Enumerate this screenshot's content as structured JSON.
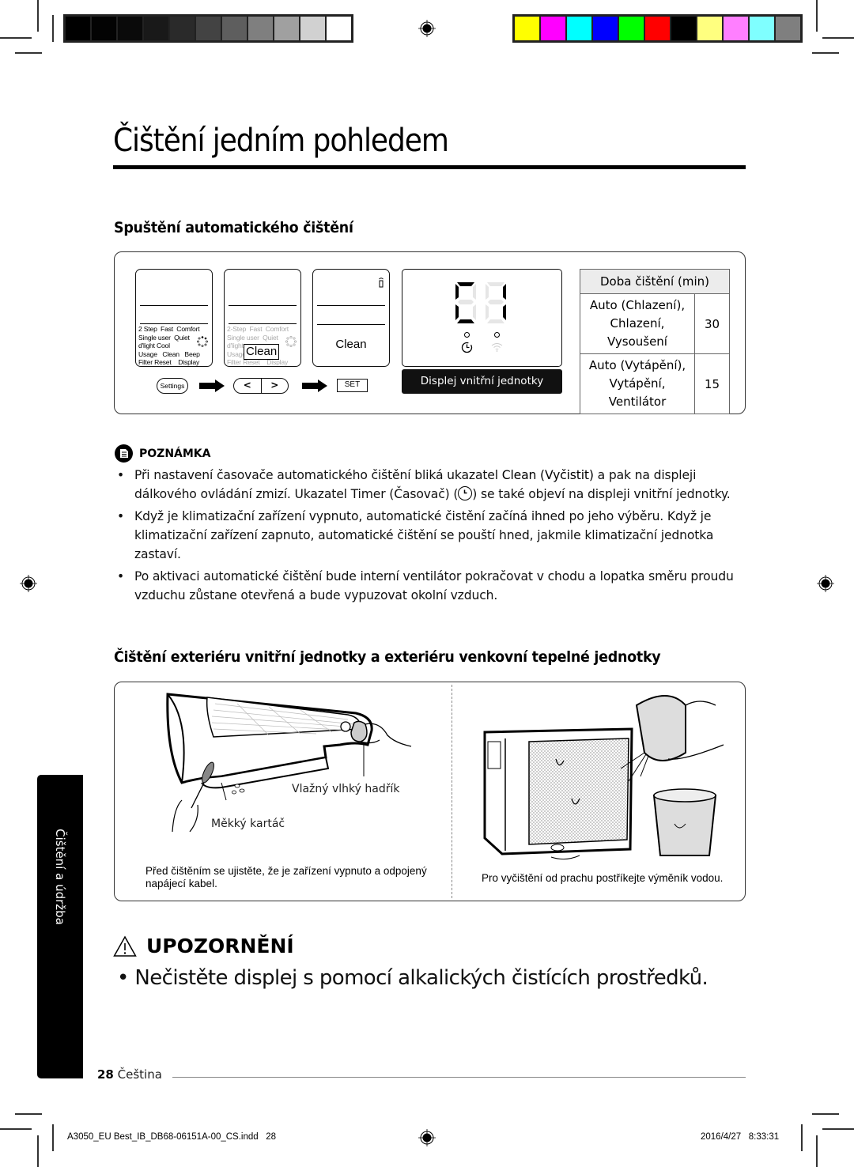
{
  "print_marks": {
    "gray_swatches": [
      "#000000",
      "#030303",
      "#0a0a0a",
      "#191919",
      "#2a2a2a",
      "#434343",
      "#5e5e5e",
      "#7f7f7f",
      "#a0a0a0",
      "#d1d1d1",
      "#ffffff"
    ],
    "color_swatches": [
      "#ffff00",
      "#ff00ff",
      "#00ffff",
      "#0000ff",
      "#00ff00",
      "#ff0000",
      "#000000",
      "#ffff7f",
      "#ff7fff",
      "#7fffff",
      "#7f7f7f"
    ]
  },
  "page": {
    "title": "Čištění jedním pohledem",
    "section1_heading": "Spuštění automatického čištění",
    "section2_heading": "Čištění exteriéru vnitřní jednotky a exteriéru venkovní tepelné jednotky"
  },
  "remote": {
    "options_lines": [
      "2 Step  Fast  Comfort",
      "Single user  Quiet",
      "d'light Cool",
      "Usage   Clean   Beep",
      "Filter Reset    Display"
    ],
    "options_lines_dim": [
      "2-Step  Fast  Comfort",
      "Single user  Quiet",
      "d'light",
      "Usage",
      "Filter Reset    Display"
    ],
    "highlight_label": "Clean",
    "screen3_label": "Clean",
    "settings_button": "Settings",
    "left_button": "<",
    "right_button": ">",
    "set_button": "SET"
  },
  "indoor_display": {
    "digits": "C1",
    "digit1_segments_on": [
      "a",
      "d",
      "e",
      "f"
    ],
    "digit2_segments_on": [
      "b",
      "c"
    ],
    "timer_icon": "timer-icon",
    "wifi_icon": "wifi-icon",
    "label": "Displej vnitřní jednotky"
  },
  "clean_time_table": {
    "header": "Doba čištění (min)",
    "rows": [
      {
        "modes": [
          "Auto (Chlazení),",
          "Chlazení,",
          "Vysoušení"
        ],
        "minutes": "30"
      },
      {
        "modes": [
          "Auto (Vytápění),",
          "Vytápění,",
          "Ventilátor"
        ],
        "minutes": "15"
      }
    ]
  },
  "note": {
    "heading": "POZNÁMKA",
    "b1_part1": "Při nastavení časovače automatického čištění bliká ukazatel ",
    "b1_bold": "Clean (Vyčistit)",
    "b1_part2": " a pak na displeji dálkového ovládání zmizí. Ukazatel Timer (Časovač) (",
    "b1_part3": ") se také objeví na displeji vnitřní jednotky.",
    "b2": "Když je klimatizační zařízení vypnuto, automatické čistění začíná ihned po jeho výběru. Když je klimatizační zařízení zapnuto, automatické čištění se pouští hned, jakmile klimatizační jednotka zastaví.",
    "b3": "Po aktivaci automatické čištění bude interní ventilátor pokračovat v chodu a lopatka směru proudu vzduchu zůstane otevřená a bude vypuzovat okolní vzduch."
  },
  "illustration": {
    "label_cloth": "Vlažný vlhký hadřík",
    "label_brush": "Měkký kartáč",
    "caption_left": "Před čištěním se ujistěte, že je zařízení vypnuto a odpojený napájecí kabel.",
    "caption_right": "Pro vyčištění od prachu postříkejte výměník vodou."
  },
  "side_tab": "Čištění a údržba",
  "warning": {
    "heading": "UPOZORNĚNÍ",
    "text": "Nečistěte displej s pomocí alkalických čistících prostředků."
  },
  "footer": {
    "page_number": "28",
    "language": "Čeština",
    "slug_file": "A3050_EU Best_IB_DB68-06151A-00_CS.indd   28",
    "slug_date": "2016/4/27   8:33:31"
  }
}
